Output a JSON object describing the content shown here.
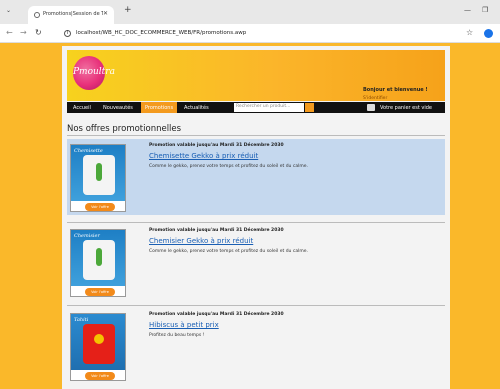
{
  "browser": {
    "tab_title": "Promotions|Session de Test",
    "url": "localhost/WB_HC_DOC_ECOMMERCE_WEB/FR/promotions.awp"
  },
  "header": {
    "logo_text": "Pmoultra",
    "welcome": "Bonjour et bienvenue !",
    "signin": "S'identifier",
    "cart": "Votre panier est vide"
  },
  "menu": {
    "items": [
      "Accueil",
      "Nouveautés",
      "Promotions",
      "Actualités"
    ],
    "search_placeholder": "Rechercher un produit..."
  },
  "page_title": "Nos offres promotionnelles",
  "offers": [
    {
      "validity": "Promotion valable jusqu'au Mardi 31 Décembre 2030",
      "title": "Chemisette Gekko à prix réduit",
      "desc": "Comme le gekko, prenez votre temps et profitez du soleil et du calme.",
      "brand": "Chemisette",
      "button": "Voir l'offre"
    },
    {
      "validity": "Promotion valable jusqu'au Mardi 31 Décembre 2030",
      "title": "Chemisier Gekko à prix réduit",
      "desc": "Comme le gekko, prenez votre temps et profitez du soleil et du calme.",
      "brand": "Chemisier",
      "button": "Voir l'offre"
    },
    {
      "validity": "Promotion valable jusqu'au Mardi 31 Décembre 2030",
      "title": "Hibiscus à petit prix",
      "desc": "Profitez du beau temps !",
      "brand": "Tahiti",
      "button": "Voir l'offre"
    }
  ]
}
